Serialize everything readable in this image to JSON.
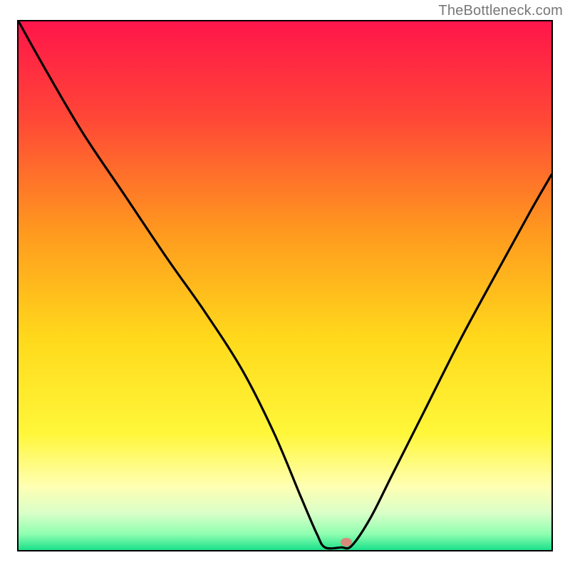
{
  "watermark": "TheBottleneck.com",
  "chart_data": {
    "type": "line",
    "title": "",
    "xlabel": "",
    "ylabel": "",
    "xlim": [
      0,
      100
    ],
    "ylim": [
      0,
      100
    ],
    "grid": false,
    "legend": false,
    "gradient_stops": [
      {
        "offset": 0.0,
        "color": "#ff154a"
      },
      {
        "offset": 0.18,
        "color": "#ff4637"
      },
      {
        "offset": 0.4,
        "color": "#ff9a1e"
      },
      {
        "offset": 0.6,
        "color": "#ffd91b"
      },
      {
        "offset": 0.78,
        "color": "#fff73a"
      },
      {
        "offset": 0.88,
        "color": "#ffffb3"
      },
      {
        "offset": 0.93,
        "color": "#d9ffc8"
      },
      {
        "offset": 0.97,
        "color": "#8effb0"
      },
      {
        "offset": 1.0,
        "color": "#1be08a"
      }
    ],
    "series": [
      {
        "name": "bottleneck-curve",
        "color": "#000000",
        "x": [
          0,
          5,
          12,
          20,
          28,
          35,
          42,
          48,
          53,
          56,
          57.5,
          60.5,
          62.5,
          66,
          70,
          76,
          83,
          90,
          96,
          100
        ],
        "y": [
          100,
          91,
          79,
          67,
          55,
          45,
          34,
          22,
          10,
          3,
          0.5,
          0.5,
          0.8,
          6,
          14,
          26,
          40,
          53,
          64,
          71
        ]
      }
    ],
    "marker": {
      "name": "optimal-point",
      "x": 61.5,
      "y": 1.5,
      "color": "#d88a7a",
      "rx": 8,
      "ry": 6
    }
  }
}
